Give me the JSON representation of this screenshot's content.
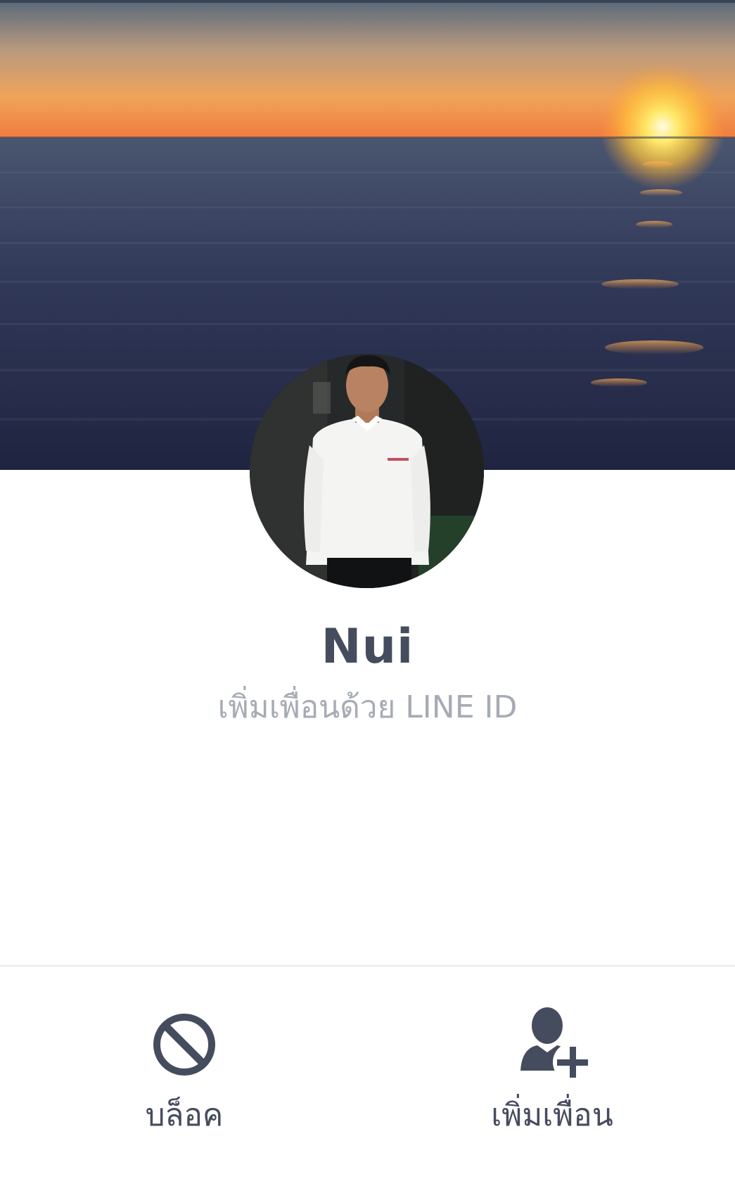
{
  "profile": {
    "name": "Nui",
    "add_by_line_id": "เพิ่มเพื่อนด้วย LINE ID"
  },
  "actions": {
    "block_label": "บล็อค",
    "add_friend_label": "เพิ่มเพื่อน"
  },
  "colors": {
    "text_primary": "#454c5e",
    "text_secondary": "#a6abb5",
    "icon": "#454c5e",
    "divider": "#e7e8eb"
  },
  "icons": {
    "block": "block-icon",
    "add_friend": "add-friend-icon"
  }
}
